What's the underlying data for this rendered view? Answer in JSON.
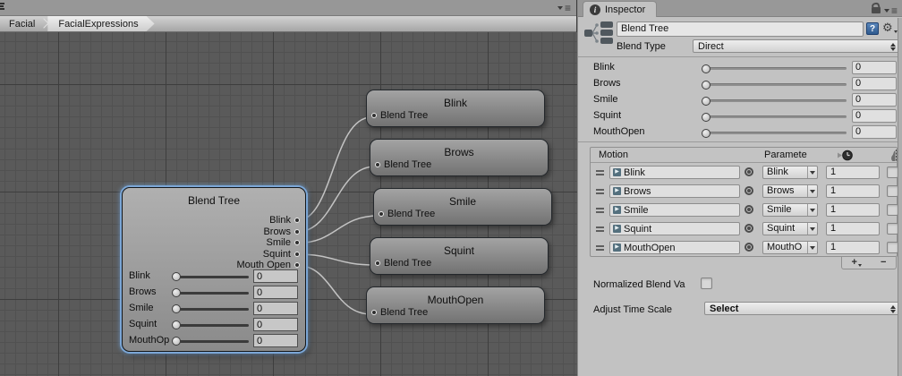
{
  "graph_pane": {
    "breadcrumb": {
      "items": [
        {
          "label": "Facial"
        },
        {
          "label": "FacialExpressions"
        }
      ]
    },
    "main_node": {
      "title": "Blend Tree",
      "outputs": [
        {
          "label": "Blink"
        },
        {
          "label": "Brows"
        },
        {
          "label": "Smile"
        },
        {
          "label": "Squint"
        },
        {
          "label": "Mouth Open"
        }
      ],
      "sliders": [
        {
          "label": "Blink",
          "value": "0"
        },
        {
          "label": "Brows",
          "value": "0"
        },
        {
          "label": "Smile",
          "value": "0"
        },
        {
          "label": "Squint",
          "value": "0"
        },
        {
          "label": "MouthOp",
          "value": "0"
        }
      ]
    },
    "child_nodes": [
      {
        "title": "Blink",
        "port_label": "Blend Tree"
      },
      {
        "title": "Brows",
        "port_label": "Blend Tree"
      },
      {
        "title": "Smile",
        "port_label": "Blend Tree"
      },
      {
        "title": "Squint",
        "port_label": "Blend Tree"
      },
      {
        "title": "MouthOpen",
        "port_label": "Blend Tree"
      }
    ]
  },
  "inspector": {
    "tab_label": "Inspector",
    "header": {
      "name_value": "Blend Tree",
      "blend_type_label": "Blend Type",
      "blend_type_value": "Direct"
    },
    "parameters": [
      {
        "label": "Blink",
        "value": "0"
      },
      {
        "label": "Brows",
        "value": "0"
      },
      {
        "label": "Smile",
        "value": "0"
      },
      {
        "label": "Squint",
        "value": "0"
      },
      {
        "label": "MouthOpen",
        "value": "0"
      }
    ],
    "motion_table": {
      "motion_header": "Motion",
      "parameter_header": "Paramete",
      "rows": [
        {
          "motion": "Blink",
          "parameter": "Blink",
          "weight": "1"
        },
        {
          "motion": "Brows",
          "parameter": "Brows",
          "weight": "1"
        },
        {
          "motion": "Smile",
          "parameter": "Smile",
          "weight": "1"
        },
        {
          "motion": "Squint",
          "parameter": "Squint",
          "weight": "1"
        },
        {
          "motion": "MouthOpen",
          "parameter": "MouthO",
          "weight": "1"
        }
      ],
      "add_label": "+",
      "remove_label": "−"
    },
    "normalized_label": "Normalized Blend Va",
    "time_scale_label": "Adjust Time Scale",
    "time_scale_value": "Select"
  },
  "colors": {
    "selection_blue": "#7ba6d6",
    "graph_bg": "#5a5a5a",
    "inspector_bg": "#c2c2c2",
    "wire": "#cccccc",
    "help_icon_blue": "#2e5a8f"
  }
}
